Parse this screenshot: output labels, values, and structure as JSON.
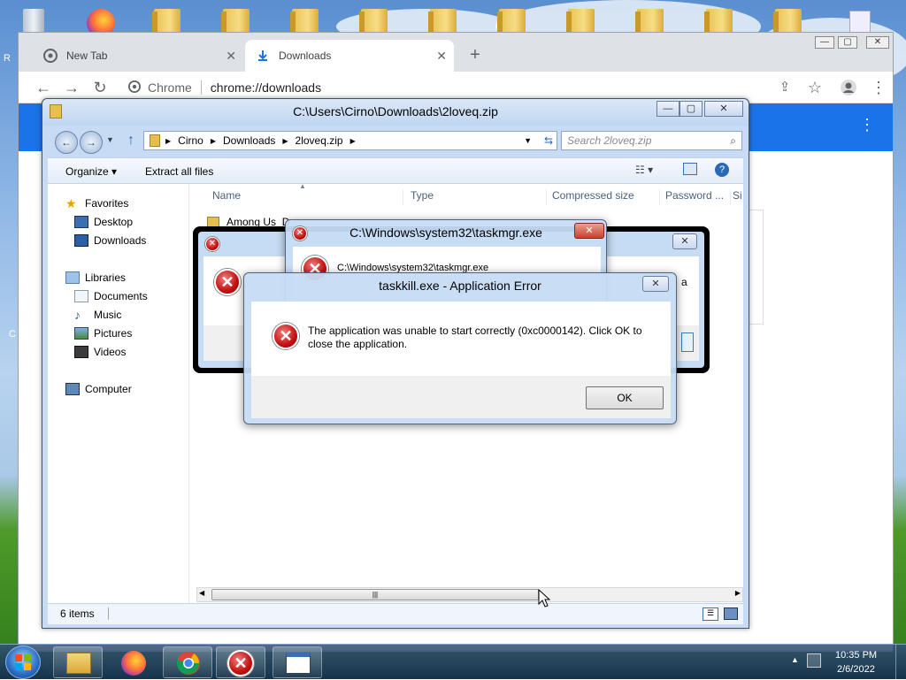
{
  "chrome": {
    "tabs": [
      {
        "label": "New Tab",
        "icon": "chrome-logo-icon"
      },
      {
        "label": "Downloads",
        "icon": "download-icon"
      }
    ],
    "omnibox": {
      "site_label": "Chrome",
      "url": "chrome://downloads"
    },
    "accent": "#1a73e8"
  },
  "explorer": {
    "title": "C:\\Users\\Cirno\\Downloads\\2loveq.zip",
    "breadcrumb": [
      "Cirno",
      "Downloads",
      "2loveq.zip"
    ],
    "search_placeholder": "Search 2loveq.zip",
    "commands": {
      "organize": "Organize",
      "extract": "Extract all files"
    },
    "sidebar": {
      "favorites": "Favorites",
      "favorites_items": [
        "Desktop",
        "Downloads"
      ],
      "libraries": "Libraries",
      "libraries_items": [
        "Documents",
        "Music",
        "Pictures",
        "Videos"
      ],
      "computer": "Computer"
    },
    "columns": [
      "Name",
      "Type",
      "Compressed size",
      "Password ...",
      "Si"
    ],
    "first_item": "Among Us_D",
    "status": "6 items"
  },
  "dialogs": {
    "back": {
      "text_fragment": "a"
    },
    "middle": {
      "title": "C:\\Windows\\system32\\taskmgr.exe",
      "message": "C:\\Windows\\system32\\taskmgr.exe"
    },
    "front": {
      "title": "taskkill.exe - Application Error",
      "message": "The application was unable to start correctly (0xc0000142). Click OK to close the application.",
      "ok_label": "OK"
    }
  },
  "taskbar": {
    "clock_time": "10:35 PM",
    "clock_date": "2/6/2022",
    "apps": [
      "explorer-icon",
      "firefox-icon",
      "chrome-icon",
      "error-icon",
      "window-icon"
    ]
  },
  "desktop": {
    "edge_labels": [
      "R",
      "C"
    ]
  }
}
